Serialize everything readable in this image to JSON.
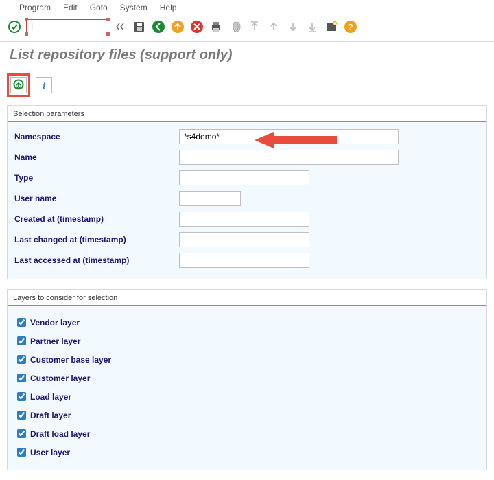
{
  "menu": {
    "items": [
      "Program",
      "Edit",
      "Goto",
      "System",
      "Help"
    ]
  },
  "toolbar": {
    "command_value": "|"
  },
  "page": {
    "title": "List repository files (support only)"
  },
  "groups": {
    "selection": {
      "title": "Selection parameters",
      "fields": {
        "namespace": {
          "label": "Namespace",
          "value": "*s4demo*"
        },
        "name": {
          "label": "Name",
          "value": ""
        },
        "type": {
          "label": "Type",
          "value": ""
        },
        "user": {
          "label": "User name",
          "value": ""
        },
        "created": {
          "label": "Created at (timestamp)",
          "value": ""
        },
        "changed": {
          "label": "Last changed at (timestamp)",
          "value": ""
        },
        "accessed": {
          "label": "Last accessed at (timestamp)",
          "value": ""
        }
      }
    },
    "layers": {
      "title": "Layers to consider for selection",
      "items": [
        {
          "label": "Vendor layer",
          "checked": true
        },
        {
          "label": "Partner layer",
          "checked": true
        },
        {
          "label": "Customer base layer",
          "checked": true
        },
        {
          "label": "Customer layer",
          "checked": true
        },
        {
          "label": "Load layer",
          "checked": true
        },
        {
          "label": "Draft layer",
          "checked": true
        },
        {
          "label": "Draft load layer",
          "checked": true
        },
        {
          "label": "User layer",
          "checked": true
        }
      ]
    }
  }
}
